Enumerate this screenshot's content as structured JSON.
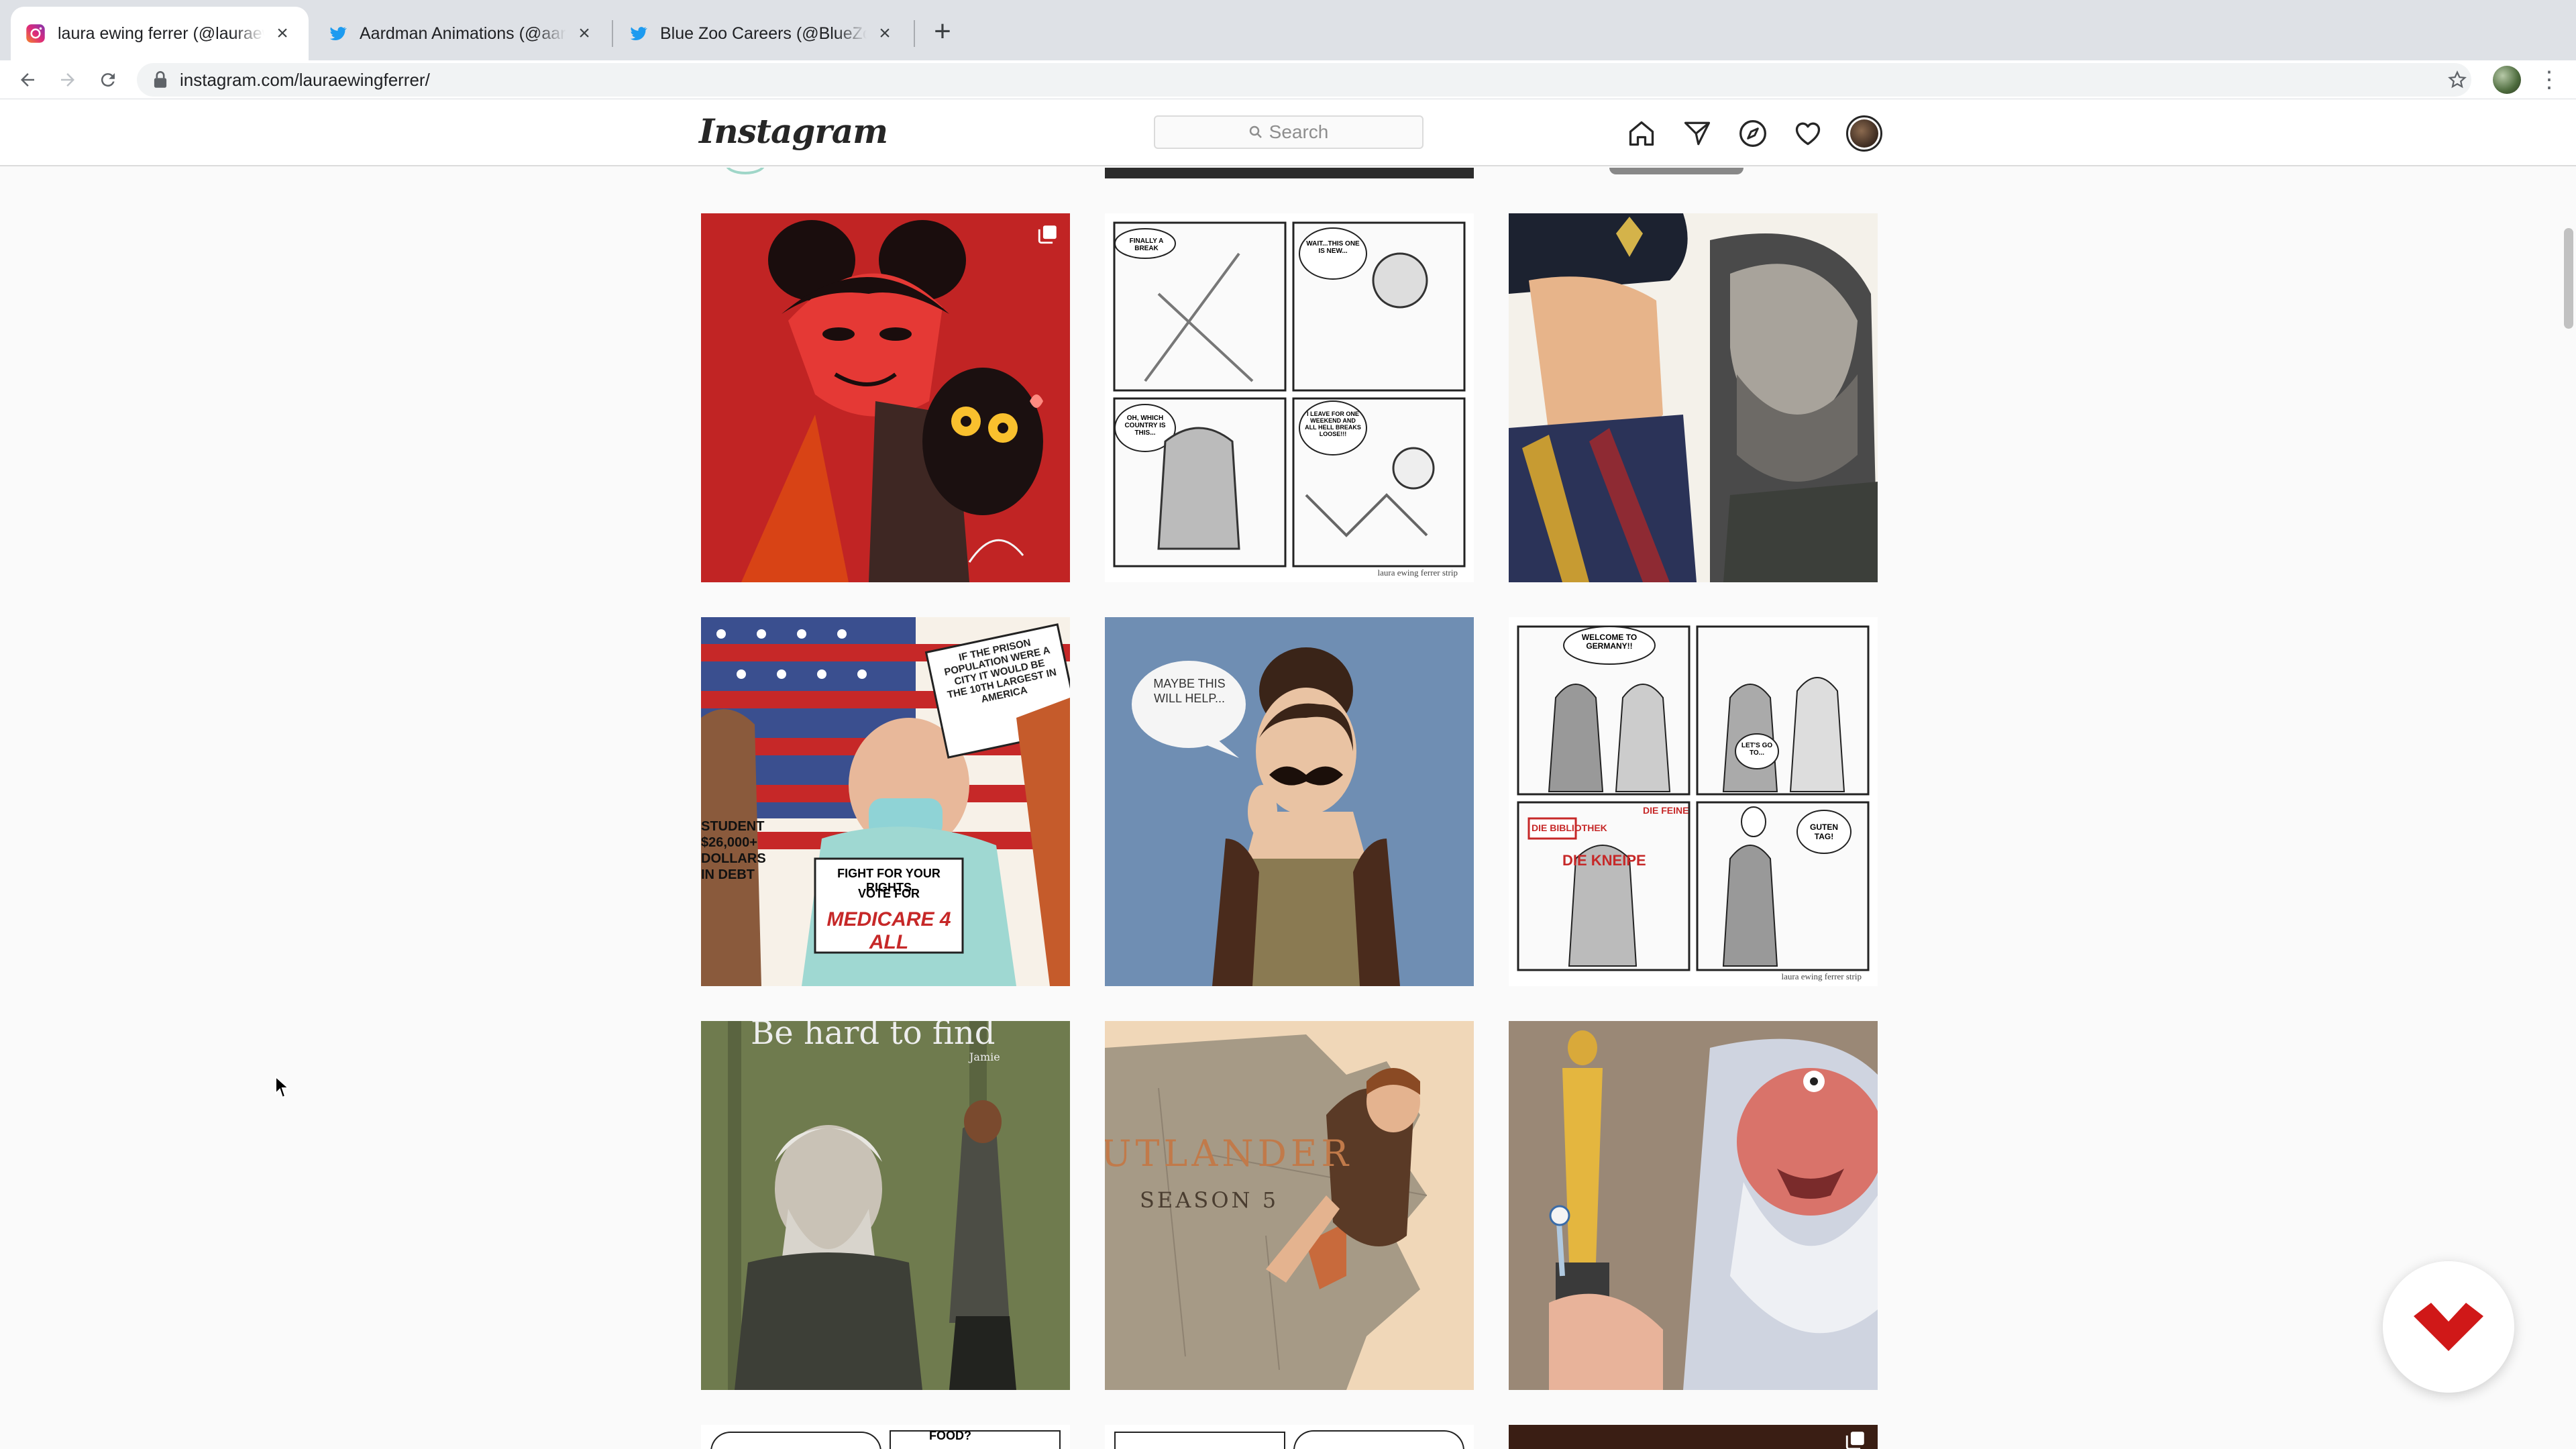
{
  "browser": {
    "tabs": [
      {
        "title": "laura ewing ferrer (@lauraewin",
        "favicon": "instagram-icon",
        "active": true
      },
      {
        "title": "Aardman Animations (@aardm",
        "favicon": "twitter-icon",
        "active": false
      },
      {
        "title": "Blue Zoo Careers (@BlueZooC",
        "favicon": "twitter-icon",
        "active": false
      }
    ],
    "close_glyph": "×",
    "new_tab_glyph": "+",
    "url": "instagram.com/lauraewingferrer/",
    "kebab_glyph": "⋮"
  },
  "instagram": {
    "logo": "Instagram",
    "search_placeholder": "Search",
    "nav_icons": [
      "home-icon",
      "direct-icon",
      "explore-icon",
      "activity-heart-icon",
      "profile-avatar"
    ]
  },
  "posts": {
    "row1": [
      {
        "name": "devil-girl-with-black-cat",
        "multi": true
      },
      {
        "name": "comic-strip-quarantine",
        "multi": false,
        "credit": "laura ewing ferrer strip",
        "bubbles": [
          "FINALLY A BREAK",
          "WAIT...THIS ONE IS NEW...",
          "OH, WHICH COUNTRY IS THIS...",
          "I LEAVE FOR ONE WEEKEND AND ALL HELL BREAKS LOOSE!!!"
        ]
      },
      {
        "name": "pirate-and-old-man",
        "multi": false
      }
    ],
    "row2": [
      {
        "name": "medicare-4-all",
        "multi": false,
        "texts": {
          "sign_top": "IF THE PRISON POPULATION WERE A CITY IT WOULD BE THE 10TH LARGEST IN AMERICA",
          "left": "STUDENT $26,000+ DOLLARS IN DEBT",
          "sign_bottom_1": "FIGHT FOR YOUR RIGHTS",
          "sign_bottom_2": "VOTE FOR",
          "sign_bottom_3": "MEDICARE 4 ALL"
        }
      },
      {
        "name": "woman-with-mustache",
        "multi": false,
        "bubble": "MAYBE THIS WILL HELP..."
      },
      {
        "name": "comic-strip-germany",
        "multi": false,
        "credit": "laura ewing ferrer strip",
        "bubbles": [
          "WELCOME TO GERMANY!!",
          "LET'S GO TO...",
          "DIE BIBLIOTHEK",
          "DIE FEINE",
          "DIE KNEIPE",
          "GUTEN TAG!"
        ]
      }
    ],
    "row3": [
      {
        "name": "be-hard-to-find",
        "multi": false,
        "title": "Be hard to find",
        "subtitle": "Jamie"
      },
      {
        "name": "outlander-season-5",
        "multi": false,
        "title": "UTLANDER",
        "subtitle": "SEASON 5"
      },
      {
        "name": "oscar-statue-forky",
        "multi": false
      }
    ],
    "row4_partial": [
      {
        "name": "comic-strip-food",
        "bubble": "FOOD?"
      },
      {
        "name": "comic-strip-partial",
        "bubble": ""
      },
      {
        "name": "dark-illustration-partial",
        "multi": true
      }
    ]
  },
  "colors": {
    "ig_text": "#262626",
    "chrome_tabstrip": "#dee1e6",
    "fab_red": "#d01818"
  }
}
